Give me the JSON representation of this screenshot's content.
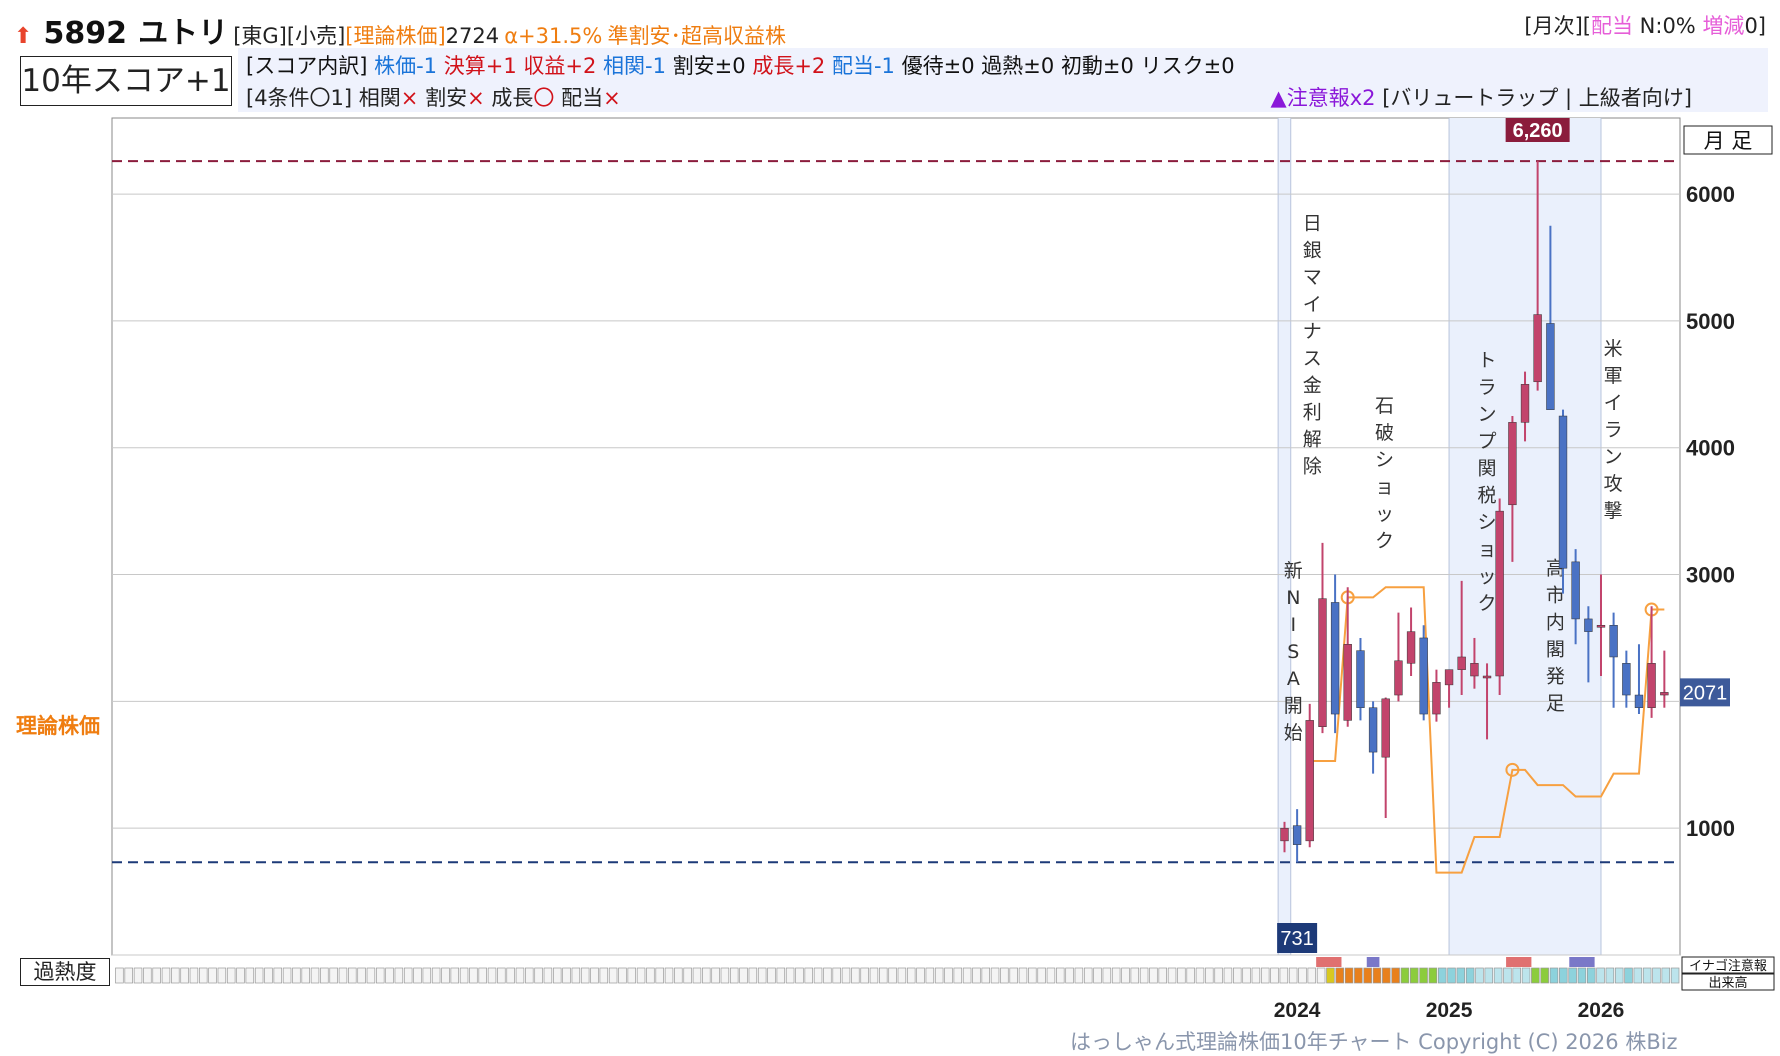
{
  "header": {
    "code": "5892",
    "name": "ユトリ",
    "market": "[東G]",
    "sector": "[小売]",
    "theory_label": "[理論株価]",
    "theory_value": "2724",
    "alpha": "α+31.5%",
    "tags": "準割安･超高収益株",
    "right_open": "[月次][",
    "right_div": "配当",
    "right_n": " N:0% ",
    "right_inc": "増減",
    "right_close": "0]"
  },
  "score": {
    "title": "10年スコア+1",
    "breakdown_label": "[スコア内訳]",
    "items": {
      "price": "株価-1",
      "earnings": "決算+1",
      "profit": "収益+2",
      "corr": "相関-1",
      "cheap": "割安±0",
      "growth": "成長+2",
      "dividend": "配当-1",
      "benefit": "優待±0",
      "overheat": "過熱±0",
      "initial": "初動±0",
      "risk": "リスク±0"
    },
    "conditions_label": "[4条件〇1]",
    "cond_corr": "相関",
    "cond_cheap": "割安",
    "cond_growth": "成長",
    "cond_div": "配当",
    "mark_x": "×",
    "mark_o": "〇",
    "warning": "▲注意報x2",
    "warning_detail": "[バリュートラップ | 上級者向け]"
  },
  "labels": {
    "theory_price": "理論株価",
    "overheat": "過熱度",
    "footer": "はっしゃん式理論株価10年チャート Copyright (C) 2026 株Biz",
    "period": "月 足",
    "inago": "イナゴ注意報",
    "volume": "出来高"
  },
  "colors": {
    "up": "#c2446c",
    "down": "#4a72c4",
    "theory": "#f7a040",
    "high_line": "#8b1c3c",
    "low_line": "#1d3a78"
  },
  "chart_data": {
    "type": "candlestick",
    "ylim": [
      0,
      6600
    ],
    "yticks": [
      1000,
      2000,
      3000,
      4000,
      5000,
      6000
    ],
    "ytick_labels": [
      "1000",
      "",
      "3000",
      "4000",
      "5000",
      "6000"
    ],
    "xtick_labels": [
      {
        "label": "2024",
        "month": 2024.0
      },
      {
        "label": "2025",
        "month": 2025.0
      },
      {
        "label": "2026",
        "month": 2026.0
      }
    ],
    "high_marker": {
      "value": 6260,
      "label": "6,260"
    },
    "low_marker": {
      "value": 731,
      "label": "731"
    },
    "last_price": {
      "value": 2071,
      "label": "2071"
    },
    "x_domain": [
      2016.2,
      2026.52
    ],
    "candles": [
      {
        "t": 2023.917,
        "o": 900,
        "h": 1050,
        "l": 810,
        "c": 1000
      },
      {
        "t": 2024.0,
        "o": 1020,
        "h": 1150,
        "l": 731,
        "c": 870
      },
      {
        "t": 2024.083,
        "o": 900,
        "h": 1980,
        "l": 850,
        "c": 1850
      },
      {
        "t": 2024.167,
        "o": 1800,
        "h": 3250,
        "l": 1750,
        "c": 2810
      },
      {
        "t": 2024.25,
        "o": 2780,
        "h": 3000,
        "l": 1750,
        "c": 1900
      },
      {
        "t": 2024.333,
        "o": 1850,
        "h": 2900,
        "l": 1800,
        "c": 2450
      },
      {
        "t": 2024.417,
        "o": 2400,
        "h": 2500,
        "l": 1850,
        "c": 1950
      },
      {
        "t": 2024.5,
        "o": 1950,
        "h": 2000,
        "l": 1430,
        "c": 1600
      },
      {
        "t": 2024.583,
        "o": 1560,
        "h": 2030,
        "l": 1080,
        "c": 2020
      },
      {
        "t": 2024.667,
        "o": 2050,
        "h": 2700,
        "l": 2000,
        "c": 2320
      },
      {
        "t": 2024.75,
        "o": 2300,
        "h": 2740,
        "l": 2200,
        "c": 2550
      },
      {
        "t": 2024.833,
        "o": 2500,
        "h": 2600,
        "l": 1850,
        "c": 1900
      },
      {
        "t": 2024.917,
        "o": 1900,
        "h": 2250,
        "l": 1840,
        "c": 2150
      },
      {
        "t": 2025.0,
        "o": 2130,
        "h": 2250,
        "l": 1950,
        "c": 2250
      },
      {
        "t": 2025.083,
        "o": 2250,
        "h": 2950,
        "l": 2050,
        "c": 2350
      },
      {
        "t": 2025.167,
        "o": 2200,
        "h": 2500,
        "l": 2100,
        "c": 2300
      },
      {
        "t": 2025.25,
        "o": 2200,
        "h": 2300,
        "l": 1700,
        "c": 2200
      },
      {
        "t": 2025.333,
        "o": 2200,
        "h": 3600,
        "l": 2050,
        "c": 3500
      },
      {
        "t": 2025.417,
        "o": 3550,
        "h": 4250,
        "l": 3100,
        "c": 4200
      },
      {
        "t": 2025.5,
        "o": 4200,
        "h": 4600,
        "l": 4050,
        "c": 4500
      },
      {
        "t": 2025.583,
        "o": 4520,
        "h": 6260,
        "l": 4450,
        "c": 5050
      },
      {
        "t": 2025.667,
        "o": 4980,
        "h": 5750,
        "l": 4300,
        "c": 4300
      },
      {
        "t": 2025.75,
        "o": 4250,
        "h": 4300,
        "l": 2850,
        "c": 3050
      },
      {
        "t": 2025.833,
        "o": 3100,
        "h": 3200,
        "l": 2450,
        "c": 2650
      },
      {
        "t": 2025.917,
        "o": 2650,
        "h": 2750,
        "l": 2150,
        "c": 2550
      },
      {
        "t": 2026.0,
        "o": 2600,
        "h": 3000,
        "l": 2200,
        "c": 2600
      },
      {
        "t": 2026.083,
        "o": 2600,
        "h": 2700,
        "l": 1950,
        "c": 2350
      },
      {
        "t": 2026.167,
        "o": 2300,
        "h": 2400,
        "l": 1950,
        "c": 2050
      },
      {
        "t": 2026.25,
        "o": 2050,
        "h": 2450,
        "l": 1900,
        "c": 1950
      },
      {
        "t": 2026.333,
        "o": 1950,
        "h": 2750,
        "l": 1870,
        "c": 2300
      },
      {
        "t": 2026.417,
        "o": 2050,
        "h": 2400,
        "l": 1950,
        "c": 2071
      }
    ],
    "theory_line": [
      {
        "t": 2024.083,
        "v": 1530
      },
      {
        "t": 2024.25,
        "v": 1530
      },
      {
        "t": 2024.333,
        "v": 2820
      },
      {
        "t": 2024.5,
        "v": 2820
      },
      {
        "t": 2024.583,
        "v": 2900
      },
      {
        "t": 2024.833,
        "v": 2900
      },
      {
        "t": 2024.917,
        "v": 650
      },
      {
        "t": 2025.083,
        "v": 650
      },
      {
        "t": 2025.167,
        "v": 930
      },
      {
        "t": 2025.333,
        "v": 930
      },
      {
        "t": 2025.417,
        "v": 1460
      },
      {
        "t": 2025.5,
        "v": 1460
      },
      {
        "t": 2025.583,
        "v": 1340
      },
      {
        "t": 2025.75,
        "v": 1340
      },
      {
        "t": 2025.833,
        "v": 1250
      },
      {
        "t": 2026.0,
        "v": 1250
      },
      {
        "t": 2026.083,
        "v": 1430
      },
      {
        "t": 2026.25,
        "v": 1430
      },
      {
        "t": 2026.333,
        "v": 2724
      },
      {
        "t": 2026.417,
        "v": 2724
      }
    ],
    "theory_circles": [
      {
        "t": 2024.333,
        "v": 2820
      },
      {
        "t": 2025.417,
        "v": 1460
      },
      {
        "t": 2026.333,
        "v": 2724
      }
    ],
    "shaded_ranges": [
      {
        "from": 2023.875,
        "to": 2023.958
      },
      {
        "from": 2025.0,
        "to": 2026.0
      }
    ],
    "events": [
      {
        "t": 2023.975,
        "v": 2980,
        "text": "新NISA開始"
      },
      {
        "t": 2024.1,
        "v": 5720,
        "text": "日銀マイナス金利解除"
      },
      {
        "t": 2024.575,
        "v": 4280,
        "text": "石破ショック"
      },
      {
        "t": 2025.25,
        "v": 4640,
        "text": "トランプ関税ショック"
      },
      {
        "t": 2025.7,
        "v": 3000,
        "text": "高市内閣発足"
      },
      {
        "t": 2026.08,
        "v": 4730,
        "text": "米軍イラン攻撃"
      }
    ],
    "heat_cells": [
      "gray",
      "gray",
      "gray",
      "gray",
      "gray",
      "gray",
      "gray",
      "gray",
      "gray",
      "gray",
      "gray",
      "gray",
      "gray",
      "gray",
      "gray",
      "gray",
      "gray",
      "gray",
      "gray",
      "gray",
      "gray",
      "gray",
      "gray",
      "gray",
      "gray",
      "gray",
      "gray",
      "gray",
      "gray",
      "gray",
      "gray",
      "gray",
      "gray",
      "gray",
      "gray",
      "gray",
      "gray",
      "gray",
      "gray",
      "gray",
      "gray",
      "gray",
      "gray",
      "gray",
      "gray",
      "gray",
      "gray",
      "gray",
      "gray",
      "gray",
      "gray",
      "gray",
      "gray",
      "gray",
      "gray",
      "gray",
      "gray",
      "gray",
      "gray",
      "gray",
      "gray",
      "gray",
      "gray",
      "gray",
      "gray",
      "gray",
      "gray",
      "gray",
      "gray",
      "gray",
      "gray",
      "gray",
      "gray",
      "gray",
      "gray",
      "gray",
      "gray",
      "gray",
      "gray",
      "gray",
      "gray",
      "gray",
      "gray",
      "gray",
      "gray",
      "gray",
      "gray",
      "gray",
      "gray",
      "gray",
      "gray",
      "gray",
      "gray",
      "gray",
      "gray",
      "gray",
      "gray",
      "gray",
      "gray",
      "gray",
      "gray",
      "gray",
      "gray",
      "gray",
      "gray",
      "gray",
      "gray",
      "gray",
      "gray",
      "gray",
      "gray",
      "gray",
      "gray",
      "gray",
      "gray",
      "gray",
      "gray",
      "gray",
      "gray",
      "gray",
      "gray",
      "gray",
      "gray",
      "gray",
      "gray",
      "gray",
      "gray",
      "gray",
      "gray",
      "gray",
      "yellow",
      "orange",
      "orange",
      "orange",
      "orange",
      "orange",
      "orange",
      "orange",
      "green",
      "green",
      "green",
      "green",
      "teal",
      "teal",
      "teal",
      "teal",
      "lteal",
      "lteal",
      "lteal",
      "lteal",
      "lteal",
      "lteal",
      "green",
      "green",
      "teal",
      "teal",
      "teal",
      "teal",
      "teal",
      "lteal",
      "lteal",
      "lteal",
      "teal",
      "lteal",
      "lteal",
      "lteal",
      "lteal",
      "lteal"
    ],
    "inago_marks": [
      {
        "t": 2024.167,
        "span": 2,
        "color": "#e07070"
      },
      {
        "t": 2024.5,
        "span": 1,
        "color": "#7a78c8"
      },
      {
        "t": 2025.417,
        "span": 2,
        "color": "#e07070"
      },
      {
        "t": 2025.833,
        "span": 2,
        "color": "#7a78c8"
      }
    ]
  }
}
